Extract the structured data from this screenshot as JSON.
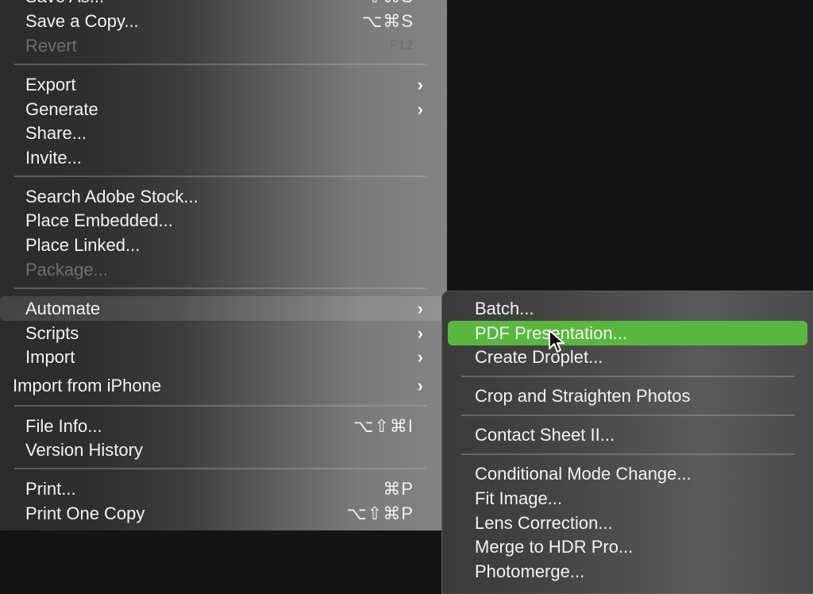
{
  "file_menu": {
    "items": [
      {
        "label": "Save As...",
        "shortcut": "⇧⌘S"
      },
      {
        "label": "Save a Copy...",
        "shortcut": "⌥⌘S"
      },
      {
        "label": "Revert",
        "shortcut": "F12",
        "disabled": true
      },
      {
        "label": "Export",
        "submenu": true
      },
      {
        "label": "Generate",
        "submenu": true
      },
      {
        "label": "Share..."
      },
      {
        "label": "Invite..."
      },
      {
        "label": "Search Adobe Stock..."
      },
      {
        "label": "Place Embedded..."
      },
      {
        "label": "Place Linked..."
      },
      {
        "label": "Package...",
        "disabled": true
      },
      {
        "label": "Automate",
        "submenu": true,
        "active": true
      },
      {
        "label": "Scripts",
        "submenu": true
      },
      {
        "label": "Import",
        "submenu": true
      },
      {
        "label": "Import from iPhone",
        "submenu": true
      },
      {
        "label": "File Info...",
        "shortcut": "⌥⇧⌘I"
      },
      {
        "label": "Version History"
      },
      {
        "label": "Print...",
        "shortcut": "⌘P"
      },
      {
        "label": "Print One Copy",
        "shortcut": "⌥⇧⌘P"
      }
    ],
    "chevron": "›"
  },
  "automate_submenu": {
    "items": [
      {
        "label": "Batch..."
      },
      {
        "label": "PDF Presentation...",
        "selected": true
      },
      {
        "label": "Create Droplet..."
      },
      {
        "label": "Crop and Straighten Photos"
      },
      {
        "label": "Contact Sheet II..."
      },
      {
        "label": "Conditional Mode Change..."
      },
      {
        "label": "Fit Image..."
      },
      {
        "label": "Lens Correction..."
      },
      {
        "label": "Merge to HDR Pro..."
      },
      {
        "label": "Photomerge..."
      }
    ]
  },
  "colors": {
    "selection": "#58b83e",
    "disabled_text": "#6e6e6e"
  }
}
